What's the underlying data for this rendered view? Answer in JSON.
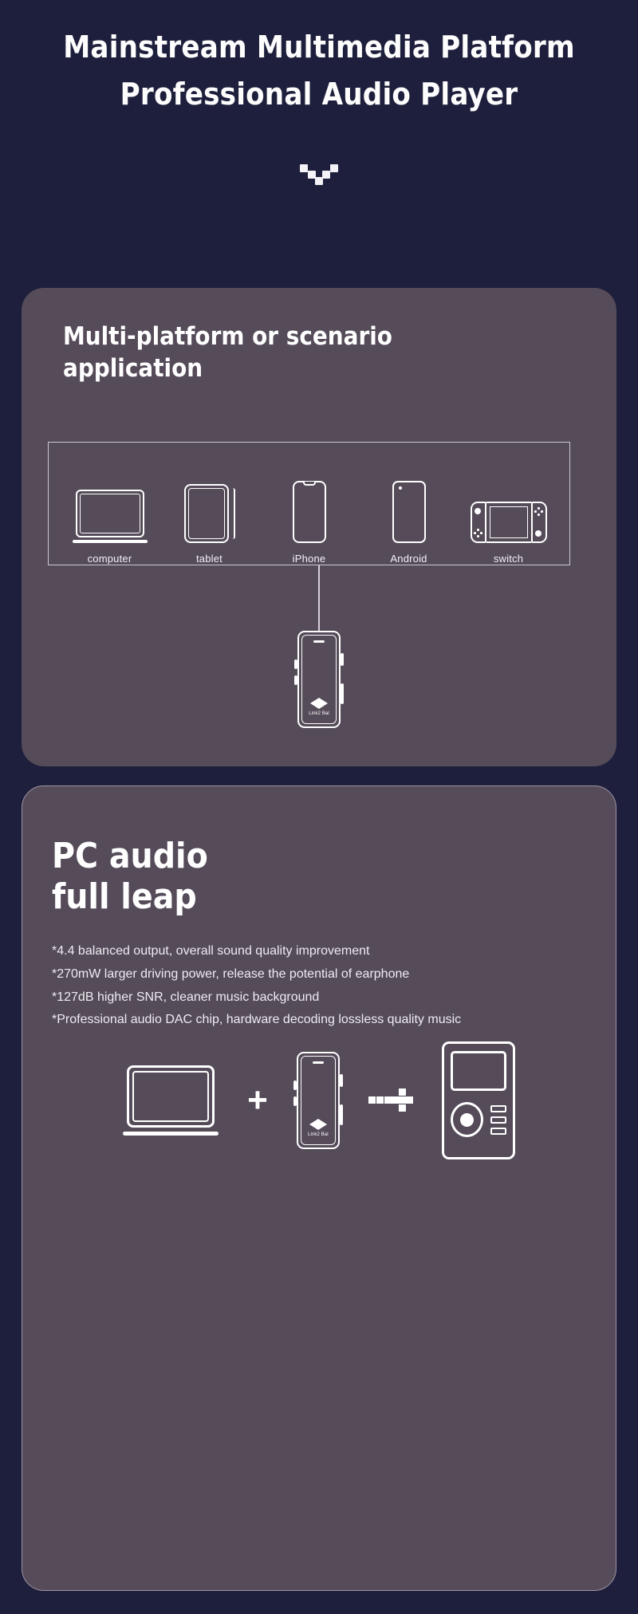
{
  "header": {
    "title_line1": "Mainstream Multimedia Platform",
    "title_line2": "Professional Audio Player",
    "logo_name": "pixel-v-logo"
  },
  "cards": {
    "platform": {
      "title_line1": "Multi-platform or scenario",
      "title_line2": "application",
      "devices": [
        {
          "label": "computer",
          "icon": "laptop-icon"
        },
        {
          "label": "tablet",
          "icon": "tablet-icon"
        },
        {
          "label": "iPhone",
          "icon": "iphone-icon"
        },
        {
          "label": "Android",
          "icon": "android-phone-icon"
        },
        {
          "label": "switch",
          "icon": "game-console-icon"
        }
      ],
      "dongle": {
        "brand_text": "Link2 Bal",
        "logo_name": "bowtie-logo"
      }
    },
    "pc_audio": {
      "title_line1": "PC audio",
      "title_line2": "full leap",
      "bullets": [
        "*4.4 balanced output, overall sound quality improvement",
        "*270mW larger driving power, release the potential of earphone",
        "*127dB higher SNR, cleaner music background",
        "*Professional audio DAC chip, hardware decoding lossless quality music"
      ],
      "combo": {
        "laptop_icon": "laptop-icon",
        "plus_symbol": "+",
        "dongle_brand_text": "Link2 Bal",
        "arrow_symbol": "pixel-arrow-right",
        "player_icon": "music-player-icon"
      }
    }
  },
  "colors": {
    "background": "#1e1f3c",
    "card": "#554b59",
    "text": "#ffffff",
    "body_text": "#efecf1",
    "outline": "#ffffff"
  }
}
